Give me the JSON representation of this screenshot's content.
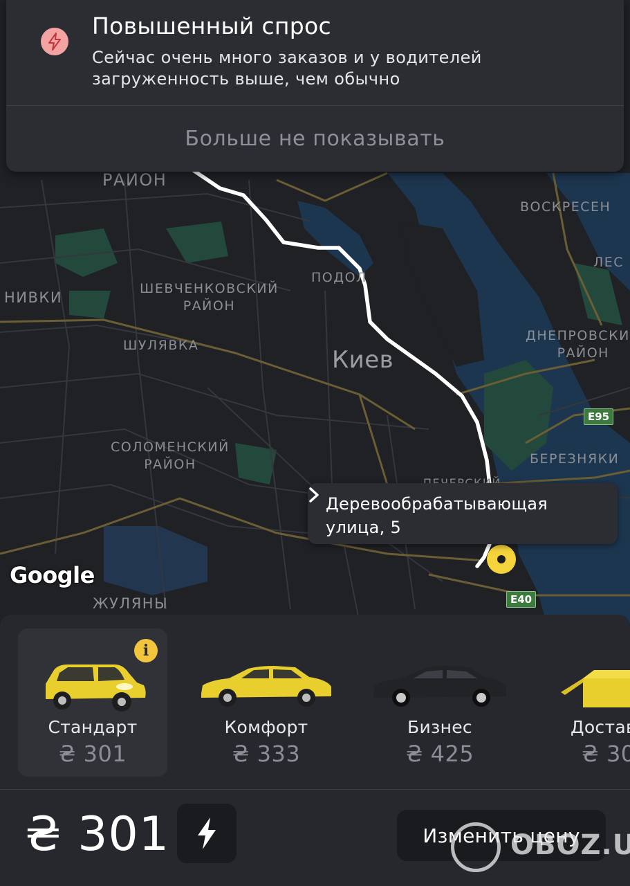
{
  "notification": {
    "title": "Повышенный спрос",
    "text": "Сейчас очень много заказов и у водителей загруженность выше, чем обычно",
    "dismiss_label": "Больше не показывать",
    "icon": "lightning-icon",
    "icon_color": "#f4a3a3"
  },
  "map": {
    "labels": {
      "raion": "РАЙОН",
      "voskresenka": "ВОСКРЕСЕН",
      "les": "ЛЕС",
      "nivki": "НИВКИ",
      "podol": "ПОДОЛ",
      "shevchenkovsky": "ШЕВЧЕНКОВСКИЙ\nРАЙОН",
      "shulyavka": "ШУЛЯВКА",
      "dneprovsky": "ДНЕПРОВСКИЙ\nРАЙОН",
      "solomensky": "СОЛОМЕНСКИЙ\nРАЙОН",
      "bereznyaki": "БЕРЕЗНЯКИ",
      "pechersky": "ПЕЧЕРСКИЙ",
      "zhulyany": "ЖУЛЯНЫ",
      "city": "Киев"
    },
    "shields": {
      "e95": "E95",
      "e40": "E40"
    },
    "attribution": "Google"
  },
  "destination": {
    "address": "Деревообрабатывающая улица, 5",
    "pin_color": "#f5d43b"
  },
  "tariffs": [
    {
      "name": "Стандарт",
      "price": "₴ 301",
      "selected": true,
      "info_badge": "i"
    },
    {
      "name": "Комфорт",
      "price": "₴ 333",
      "selected": false
    },
    {
      "name": "Бизнес",
      "price": "₴ 425",
      "selected": false
    },
    {
      "name": "Достав",
      "price": "₴ 30",
      "selected": false
    }
  ],
  "order": {
    "total_price": "₴ 301",
    "surge_icon": "lightning-icon",
    "change_price_label": "Изменить цену"
  },
  "watermark": {
    "text": "OBOZ.UA"
  },
  "colors": {
    "accent": "#f5d43b",
    "background": "#1c1d21",
    "sheet": "#26282d"
  }
}
